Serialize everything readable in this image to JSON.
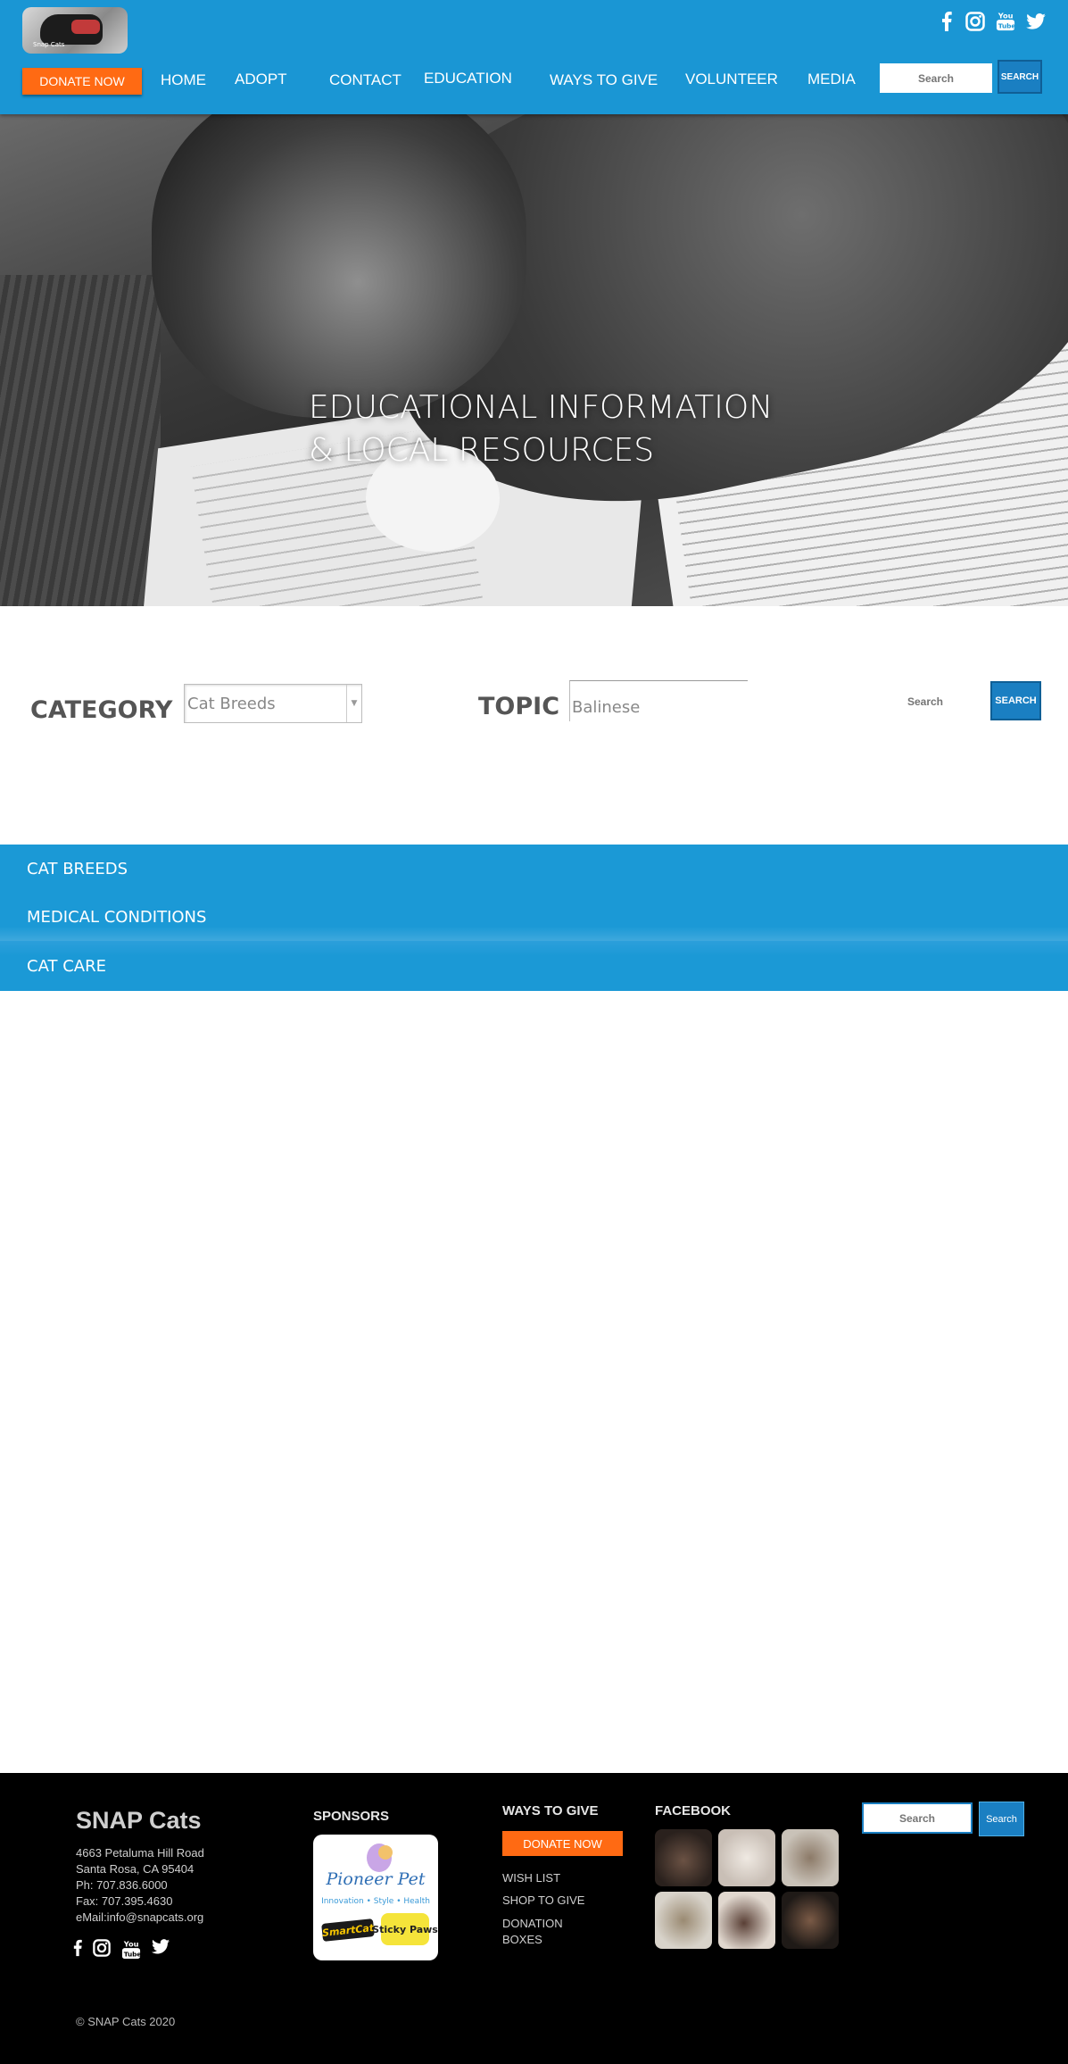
{
  "header": {
    "logo_text": "Snap Cats",
    "donate_label": "DONATE NOW",
    "nav": [
      "HOME",
      "ADOPT",
      "CONTACT",
      "EDUCATION",
      "WAYS TO GIVE",
      "VOLUNTEER",
      "MEDIA"
    ],
    "search_placeholder": "Search",
    "search_button": "SEARCH",
    "social_icons": [
      "facebook-icon",
      "instagram-icon",
      "youtube-icon",
      "twitter-icon"
    ]
  },
  "hero": {
    "title": "EDUCATIONAL INFORMATION\n & LOCAL RESOURCES"
  },
  "filter": {
    "category_label": "CATEGORY",
    "category_value": "Cat Breeds",
    "topic_label": "TOPIC",
    "topic_value": "Balinese",
    "search_placeholder": "Search",
    "search_button": "SEARCH"
  },
  "accordion": [
    "CAT BREEDS",
    "MEDICAL CONDITIONS",
    "CAT CARE"
  ],
  "footer": {
    "org_name": "SNAP Cats",
    "address": [
      "4663 Petaluma Hill Road",
      "Santa Rosa, CA 95404",
      "Ph: 707.836.6000",
      "Fax: 707.395.4630",
      "eMail:info@snapcats.org"
    ],
    "sponsors_heading": "SPONSORS",
    "sponsor_names": [
      "Pioneer Pet",
      "Innovation • Style • Health",
      "SmartCat",
      "Sticky Paws"
    ],
    "ways_heading": "WAYS TO GIVE",
    "donate_label": "DONATE NOW",
    "ways_links": [
      "WISH LIST",
      "SHOP TO GIVE",
      "DONATION\nBOXES"
    ],
    "facebook_heading": "FACEBOOK",
    "search_placeholder": "Search",
    "search_button": "Search",
    "copyright": "© SNAP Cats 2020"
  },
  "colors": {
    "brand_blue": "#1a96d4",
    "accent_orange": "#ff6a13",
    "button_blue": "#1a7fc2",
    "footer_bg": "#000000"
  }
}
